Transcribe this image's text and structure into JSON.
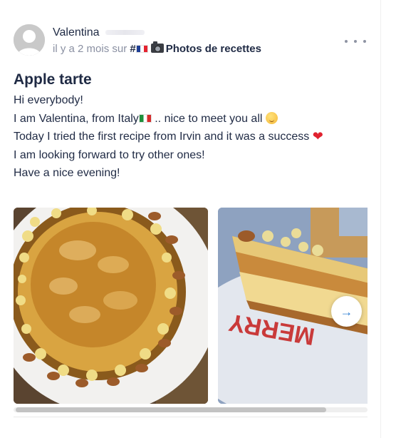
{
  "post": {
    "author": "Valentina",
    "time": "il y a 2 mois sur",
    "hashtag": "#",
    "channel": "Photos de recettes",
    "title": "Apple tarte",
    "lines": [
      "Hi everybody!",
      "I am Valentina, from Italy",
      ".. nice to meet you all",
      "Today I tried the first recipe from Irvin and it was a success",
      "I am looking forward to try other ones!",
      "Have a nice evening!"
    ],
    "next_glyph": "→",
    "icons": {
      "more": "more-horizontal-icon",
      "camera": "camera-icon",
      "next": "arrow-right-icon",
      "heart": "heart-icon"
    },
    "heart_glyph": "❤",
    "gallery_scroll_fraction": 0.88
  },
  "colors": {
    "text": "#1f2a44",
    "meta": "#8a90a2",
    "accent": "#2f7fd3"
  }
}
